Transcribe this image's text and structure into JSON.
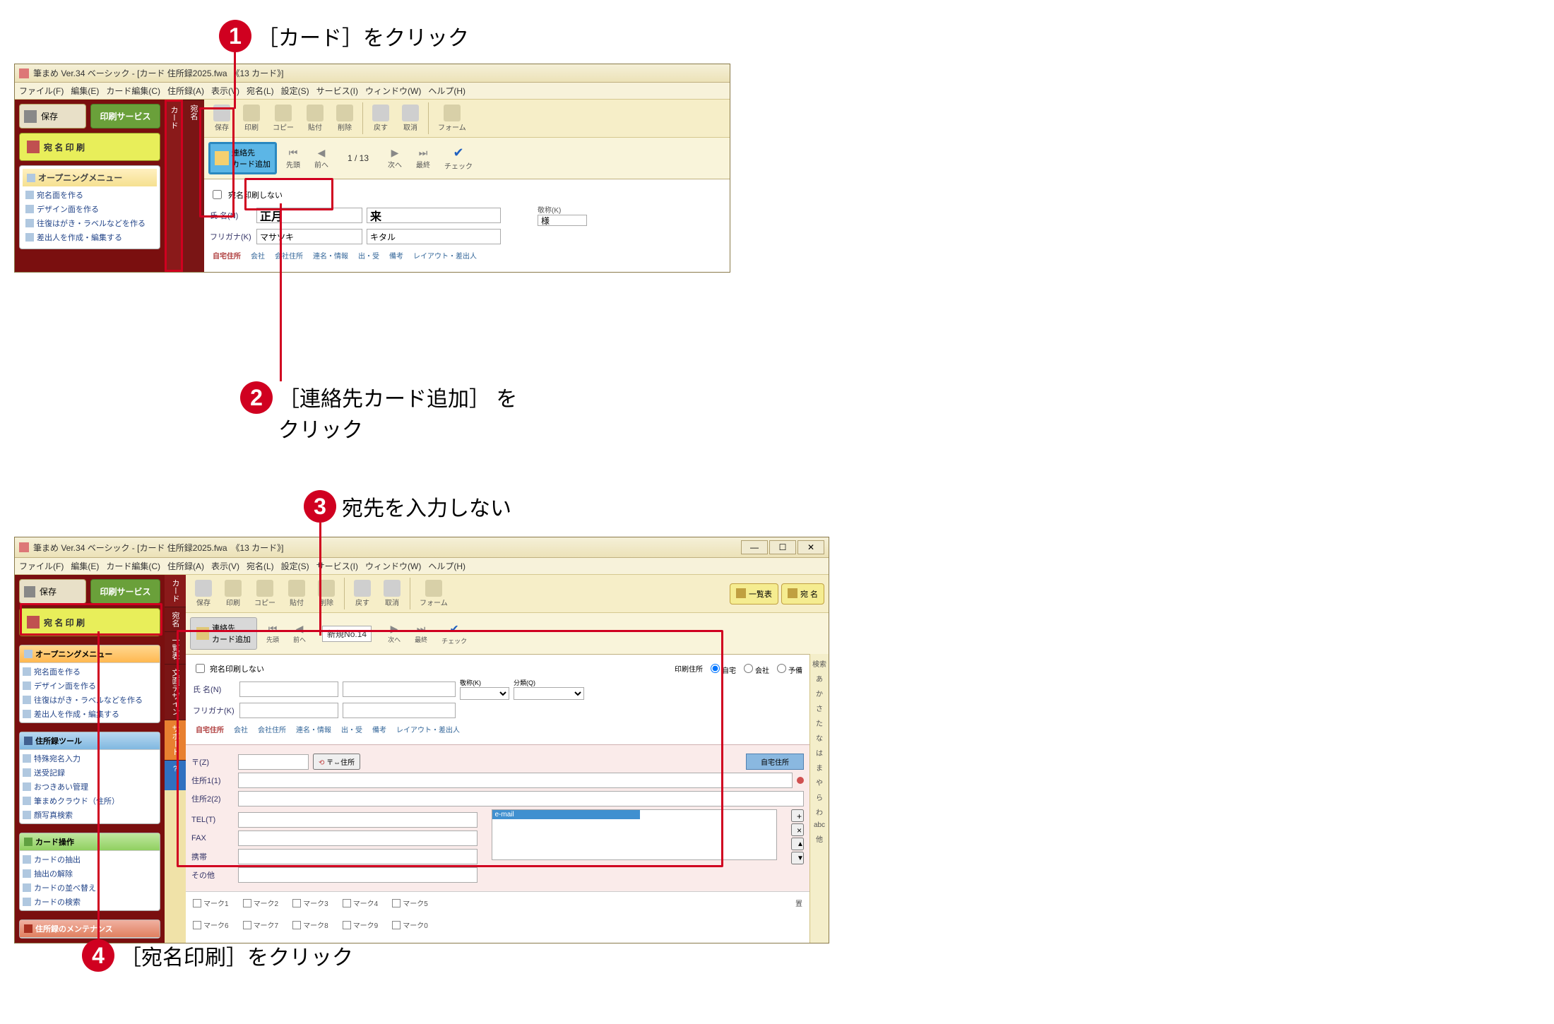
{
  "callouts": {
    "c1": {
      "n": "1",
      "text": "［カード］をクリック"
    },
    "c2": {
      "n": "2",
      "text": "［連絡先カード追加］ を\nクリック"
    },
    "c3": {
      "n": "3",
      "text": "宛先を入力しない"
    },
    "c4": {
      "n": "4",
      "text": "［宛名印刷］をクリック"
    }
  },
  "win1": {
    "title": "筆まめ Ver.34 ベーシック - [カード 住所録2025.fwa　《13 カード》]",
    "menu": [
      "ファイル(F)",
      "編集(E)",
      "カード編集(C)",
      "住所録(A)",
      "表示(V)",
      "宛名(L)",
      "設定(S)",
      "サービス(I)",
      "ウィンドウ(W)",
      "ヘルプ(H)"
    ],
    "save": "保存",
    "printService": "印刷サービス",
    "atenaPrint": "宛 名 印 刷",
    "openingMenu": "オープニングメニュー",
    "sidebarItems": [
      "宛名面を作る",
      "デザイン面を作る",
      "往復はがき・ラベルなどを作る",
      "差出人を作成・編集する"
    ],
    "vtabCard": "カード",
    "vtabAtena": "宛名",
    "toolbar": {
      "save": "保存",
      "print": "印刷",
      "copy": "コピー",
      "paste": "貼付",
      "del": "削除",
      "undo": "戻す",
      "redo": "取消",
      "form": "フォーム"
    },
    "addContact": "連絡先\nカード追加",
    "nav": {
      "first": "先頭",
      "prev": "前へ",
      "page": "1 / 13",
      "next": "次へ",
      "last": "最終",
      "check": "チェック"
    },
    "chkNoPrint": "宛名印刷しない",
    "labels": {
      "name": "氏 名(N)",
      "kana": "フリガナ(K)",
      "honor": "敬称(K)"
    },
    "values": {
      "sei": "正月",
      "mei": "来",
      "kanaSei": "マサツキ",
      "kanaMei": "キタル",
      "honor": "様"
    },
    "tabs": [
      "自宅住所",
      "会社",
      "会社住所",
      "連名・情報",
      "出・受",
      "備考",
      "レイアウト・差出人"
    ]
  },
  "win2": {
    "title": "筆まめ Ver.34 ベーシック - [カード 住所録2025.fwa　《13 カード》]",
    "menu": [
      "ファイル(F)",
      "編集(E)",
      "カード編集(C)",
      "住所録(A)",
      "表示(V)",
      "宛名(L)",
      "設定(S)",
      "サービス(I)",
      "ウィンドウ(W)",
      "ヘルプ(H)"
    ],
    "save": "保存",
    "printService": "印刷サービス",
    "atenaPrint": "宛 名 印 刷",
    "openingMenu": "オープニングメニュー",
    "sidebarItems": [
      "宛名面を作る",
      "デザイン面を作る",
      "往復はがき・ラベルなどを作る",
      "差出人を作成・編集する"
    ],
    "groups": {
      "addrTool": "住所録ツール",
      "addrItems": [
        "特殊宛名入力",
        "送受記録",
        "おつきあい管理",
        "筆まめクラウド（住所）",
        "顔写真検索"
      ],
      "cardOps": "カード操作",
      "cardItems": [
        "カードの抽出",
        "抽出の解除",
        "カードの並べ替え",
        "カードの検索"
      ],
      "addrMaint": "住所録のメンテナンス"
    },
    "vtabCard": "カード",
    "vtabAtena": "宛名",
    "vtabList": "一覧表",
    "vtabDesign": "文面デザイン",
    "vtabSupport": "サポート",
    "toolbar": {
      "save": "保存",
      "print": "印刷",
      "copy": "コピー",
      "paste": "貼付",
      "del": "削除",
      "undo": "戻す",
      "redo": "取消",
      "form": "フォーム"
    },
    "rightBtns": {
      "list": "一覧表",
      "atena": "宛 名"
    },
    "addContact": "連絡先\nカード追加",
    "nav": {
      "first": "先頭",
      "prev": "前へ",
      "pageLabel": "新規No.14",
      "next": "次へ",
      "last": "最終",
      "check": "チェック"
    },
    "chkNoPrint": "宛名印刷しない",
    "printAddrLabel": "印刷住所",
    "printAddrOpts": [
      "自宅",
      "会社",
      "予備"
    ],
    "labels": {
      "name": "氏 名(N)",
      "kana": "フリガナ(K)",
      "honor": "敬称(K)",
      "cat": "分類(Q)",
      "zip": "〒(Z)",
      "zipMap": "〒⇔住所",
      "addrBtn": "自宅住所",
      "addr1": "住所1(1)",
      "addr2": "住所2(2)",
      "tel": "TEL(T)",
      "fax": "FAX",
      "mobile": "携帯",
      "other": "その他",
      "email": "e-mail"
    },
    "tabs": [
      "自宅住所",
      "会社",
      "会社住所",
      "連名・情報",
      "出・受",
      "備考",
      "レイアウト・差出人"
    ],
    "marks": [
      "マーク1",
      "マーク2",
      "マーク3",
      "マーク4",
      "マーク5",
      "マーク6",
      "マーク7",
      "マーク8",
      "マーク9",
      "マーク0"
    ],
    "markHead": "置",
    "kanaIndex": [
      "検索",
      "あ",
      "か",
      "さ",
      "た",
      "な",
      "は",
      "ま",
      "や",
      "ら",
      "わ",
      "abc",
      "他"
    ]
  }
}
